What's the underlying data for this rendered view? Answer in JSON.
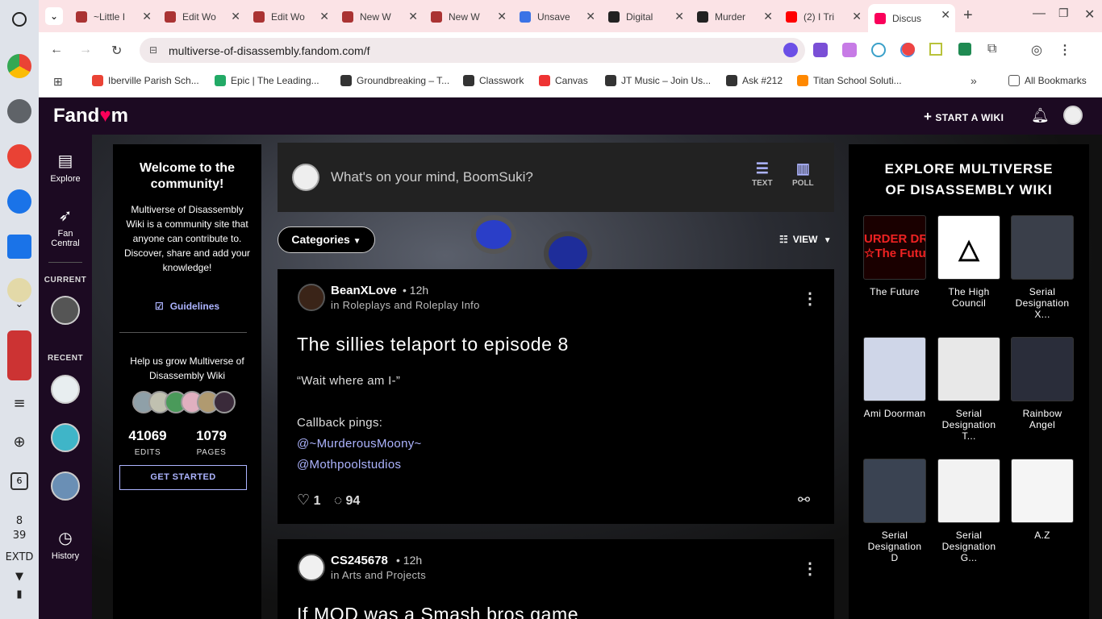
{
  "os": {
    "clock_hour": "8",
    "clock_min": "39",
    "ime": "EXTD",
    "calendar_day": "6"
  },
  "tabs": [
    {
      "title": "~Little I",
      "fav": "#a33"
    },
    {
      "title": "Edit Wo",
      "fav": "#a33"
    },
    {
      "title": "Edit Wo",
      "fav": "#a33"
    },
    {
      "title": "New W",
      "fav": "#a33"
    },
    {
      "title": "New W",
      "fav": "#a33"
    },
    {
      "title": "Unsave",
      "fav": "#3b73e6"
    },
    {
      "title": "Digital",
      "fav": "#222"
    },
    {
      "title": "Murder",
      "fav": "#222"
    },
    {
      "title": "(2) I Tri",
      "fav": "#f00"
    },
    {
      "title": "Discus",
      "fav": "#fa005a"
    }
  ],
  "address": {
    "url": "multiverse-of-disassembly.fandom.com/f"
  },
  "bookmarks": [
    {
      "label": "Iberville Parish Sch...",
      "fav": "#ea4335"
    },
    {
      "label": "Epic | The Leading...",
      "fav": "#2a6"
    },
    {
      "label": "Groundbreaking – T...",
      "fav": "#333"
    },
    {
      "label": "Classwork",
      "fav": "#333"
    },
    {
      "label": "Canvas",
      "fav": "#e33"
    },
    {
      "label": "JT Music – Join Us...",
      "fav": "#333"
    },
    {
      "label": "Ask #212",
      "fav": "#333"
    },
    {
      "label": "Titan School Soluti...",
      "fav": "#f80"
    }
  ],
  "all_bookmarks": "All Bookmarks",
  "fandom": {
    "logo_a": "Fand",
    "logo_heart": "♥",
    "logo_b": "m",
    "start_wiki": "START A WIKI"
  },
  "nav": {
    "explore": "Explore",
    "fan_central_1": "Fan",
    "fan_central_2": "Central",
    "current": "CURRENT",
    "recent": "RECENT",
    "history": "History"
  },
  "welcome": {
    "title": "Welcome to the community!",
    "desc": "Multiverse of Disassembly Wiki is a community site that anyone can contribute to. Discover, share and add your knowledge!",
    "guidelines": "Guidelines",
    "help": "Help us grow Multiverse of Disassembly Wiki",
    "edits": "41069",
    "edits_label": "EDITS",
    "pages": "1079",
    "pages_label": "PAGES",
    "get_started": "GET STARTED"
  },
  "composer": {
    "prompt": "What's on your mind, BoomSuki?",
    "text_btn": "TEXT",
    "poll_btn": "POLL"
  },
  "filters": {
    "categories": "Categories",
    "view": "VIEW"
  },
  "posts": [
    {
      "author": "BeanXLove",
      "time": "12h",
      "category": "in Roleplays and Roleplay Info",
      "title": "The sillies telaport to episode 8",
      "line1": "“Wait where am I-”",
      "line2": "Callback pings:",
      "link1": "@~MurderousMoony~",
      "link2": "@Mothpoolstudios",
      "likes": "1",
      "comments": "94"
    },
    {
      "author": "CS245678",
      "time": "12h",
      "category": "in Arts and Projects",
      "title": "If MOD was a Smash bros game"
    }
  ],
  "explore": {
    "title": "EXPLORE MULTIVERSE OF DISASSEMBLY WIKI",
    "tiles": [
      {
        "caption": "The Future",
        "color": "#1a0000"
      },
      {
        "caption": "The High Council",
        "color": "#ffffff"
      },
      {
        "caption": "Serial Designation X...",
        "color": "#3a3f4a"
      },
      {
        "caption": "Ami Doorman",
        "color": "#cfd6e8"
      },
      {
        "caption": "Serial Designation T...",
        "color": "#e8e8e8"
      },
      {
        "caption": "Rainbow Angel",
        "color": "#2a2d3a"
      },
      {
        "caption": "Serial Designation D",
        "color": "#3a4352"
      },
      {
        "caption": "Serial Designation G...",
        "color": "#f2f2f2"
      },
      {
        "caption": "A.Z",
        "color": "#f5f5f5"
      }
    ],
    "future_text_1": "URDER DR",
    "future_text_2": "☆The Future"
  }
}
